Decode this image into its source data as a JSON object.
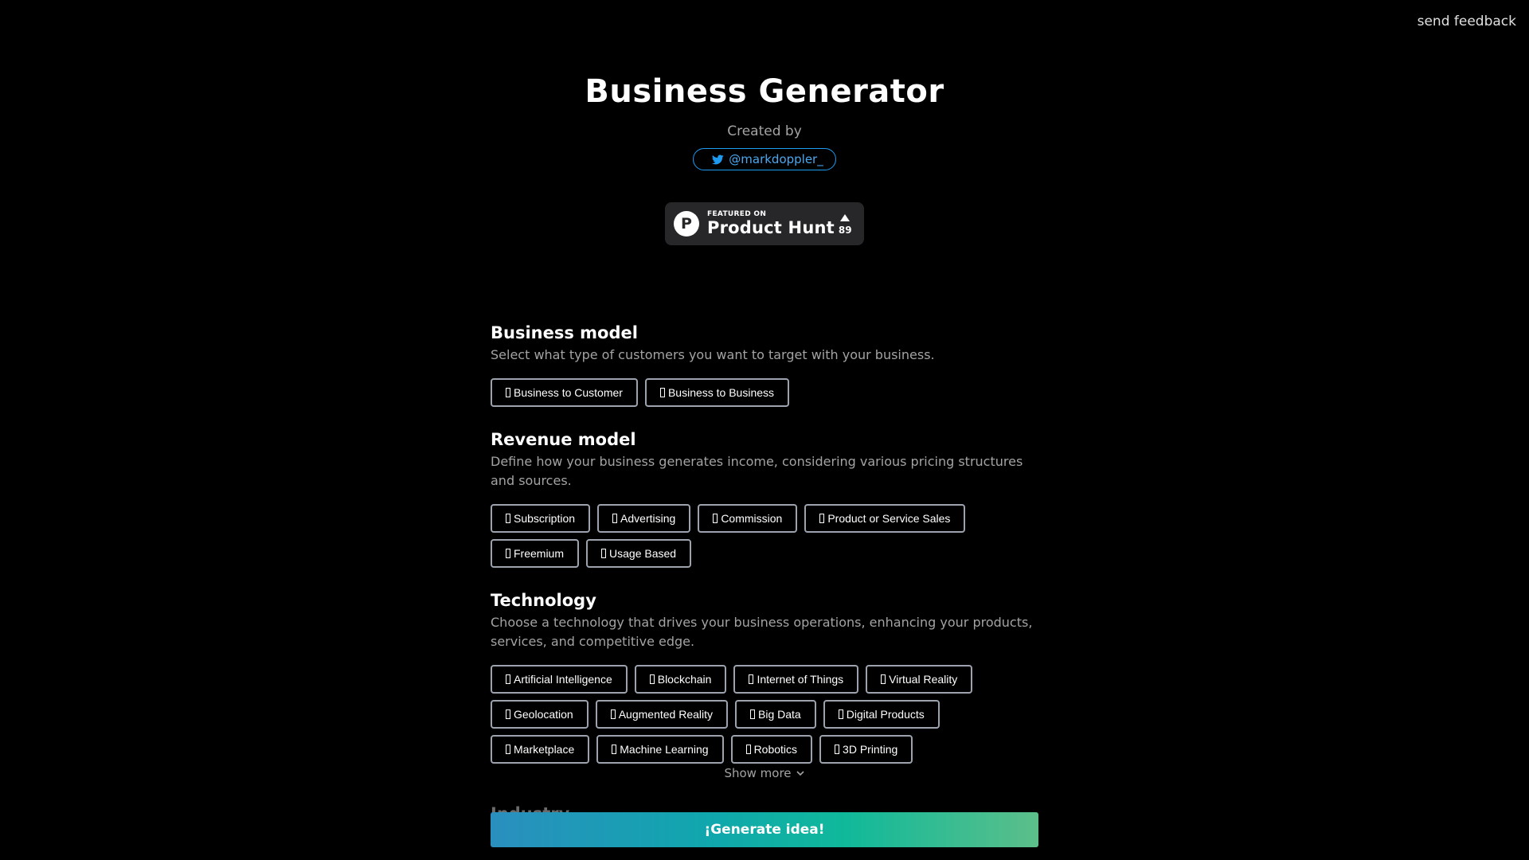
{
  "feedback_label": "send feedback",
  "header": {
    "title": "Business Generator",
    "created_by": "Created by",
    "twitter_handle": "@markdoppler_"
  },
  "product_hunt": {
    "featured_on": "FEATURED ON",
    "name": "Product Hunt",
    "logo_letter": "P",
    "votes": "89"
  },
  "sections": {
    "business_model": {
      "title": "Business model",
      "description": "Select what type of customers you want to target with your business.",
      "options": [
        "Business to Customer",
        "Business to Business"
      ]
    },
    "revenue_model": {
      "title": "Revenue model",
      "description": "Define how your business generates income, considering various pricing structures and sources.",
      "options": [
        "Subscription",
        "Advertising",
        "Commission",
        "Product or Service Sales",
        "Freemium",
        "Usage Based"
      ]
    },
    "technology": {
      "title": "Technology",
      "description": "Choose a technology that drives your business operations, enhancing your products, services, and competitive edge.",
      "options": [
        "Artificial Intelligence",
        "Blockchain",
        "Internet of Things",
        "Virtual Reality",
        "Geolocation",
        "Augmented Reality",
        "Big Data",
        "Digital Products",
        "Marketplace",
        "Machine Learning",
        "Robotics",
        "3D Printing"
      ]
    }
  },
  "show_more_label": "Show more",
  "next_section_title": "Industry",
  "generate_label": "¡Generate idea!",
  "colors": {
    "background": "#000000",
    "twitter_blue": "#1d9bf0",
    "chip_border": "#9ca3af",
    "muted_text": "#a3a3a3"
  },
  "icons": {
    "twitter": "twitter-bird-icon",
    "product_hunt": "product-hunt-logo-icon",
    "upvote": "upvote-triangle-icon",
    "show_more": "chevron-down-icon"
  }
}
